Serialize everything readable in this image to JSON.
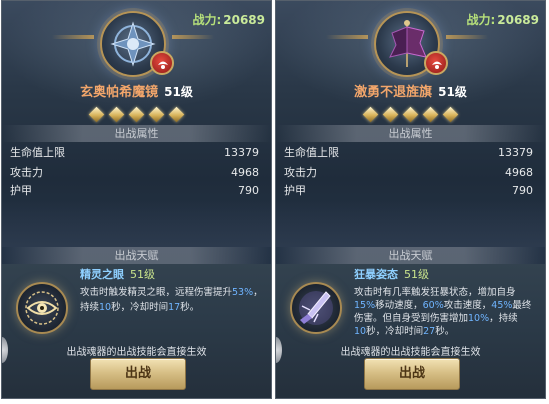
{
  "panels": [
    {
      "power_label": "战力:",
      "power_value": "20689",
      "name": "玄奥帕希魔镜",
      "level": "51级",
      "stars": 5,
      "attrs_header": "出战属性",
      "stats": [
        {
          "label": "生命值上限",
          "value": "13379"
        },
        {
          "label": "攻击力",
          "value": "4968"
        },
        {
          "label": "护甲",
          "value": "790"
        }
      ],
      "talent_header": "出战天赋",
      "talent": {
        "name": "精灵之眼",
        "level": "51级",
        "lines": [
          [
            "攻击时触发精灵之眼，远程伤害提升",
            "53%",
            "，"
          ],
          [
            "持续",
            "10",
            "秒，冷却时间",
            "17",
            "秒。"
          ]
        ]
      },
      "note": "出战魂器的出战技能会直接生效",
      "deploy_button": "出战",
      "icon": "mirror-relic-icon",
      "talent_icon": "eye-icon"
    },
    {
      "power_label": "战力:",
      "power_value": "20689",
      "name": "激勇不退旌旗",
      "level": "51级",
      "stars": 5,
      "attrs_header": "出战属性",
      "stats": [
        {
          "label": "生命值上限",
          "value": "13379"
        },
        {
          "label": "攻击力",
          "value": "4968"
        },
        {
          "label": "护甲",
          "value": "790"
        }
      ],
      "talent_header": "出战天赋",
      "talent": {
        "name": "狂暴姿态",
        "level": "51级",
        "lines": [
          [
            "攻击时有几率触发狂暴状态，增加自身"
          ],
          [
            "15%",
            "移动速度，",
            "60%",
            "攻击速度，",
            "45%",
            "最终"
          ],
          [
            "伤害。但自身受到伤害增加",
            "10%",
            "，持续"
          ],
          [
            "10",
            "秒，冷却时间",
            "27",
            "秒。"
          ]
        ]
      },
      "note": "出战魂器的出战技能会直接生效",
      "deploy_button": "出战",
      "icon": "banner-relic-icon",
      "talent_icon": "spear-burst-icon"
    }
  ],
  "colors": {
    "power": "#b6e07a",
    "name": "#f2a66b",
    "talent_name": "#8fd0ff",
    "highlight": "#6fb4ff",
    "button": "#d7bf86"
  }
}
